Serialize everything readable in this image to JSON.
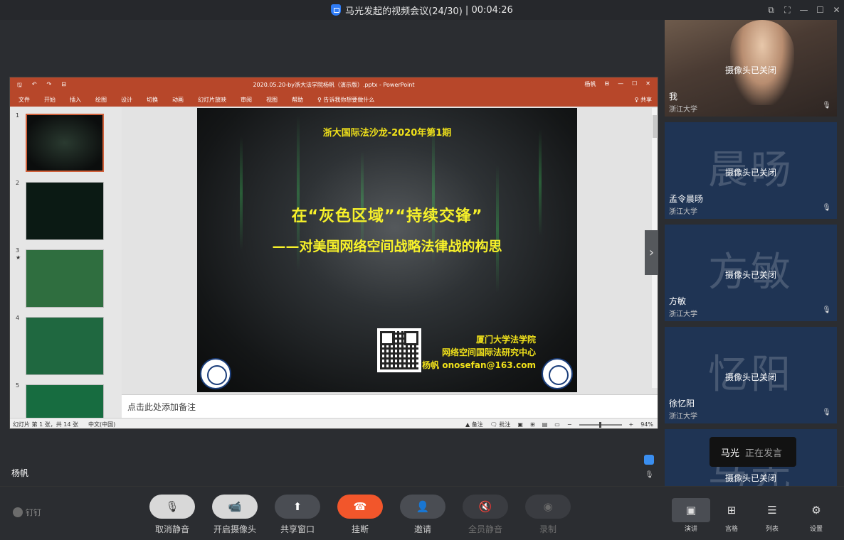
{
  "window": {
    "title": "马光发起的视频会议(24/30)",
    "timer": "00:04:26",
    "controls": [
      "⧉",
      "⛶",
      "—",
      "☐",
      "✕"
    ]
  },
  "ppt": {
    "filename": "2020.05.20-by浙大法学院杨帆（演示版）.pptx - PowerPoint",
    "quick_access": [
      "🖫",
      "↶",
      "↷",
      "⊟"
    ],
    "title_right": [
      "杨帆",
      "⊟",
      "—",
      "☐",
      "✕"
    ],
    "tabs": [
      "文件",
      "开始",
      "插入",
      "绘图",
      "设计",
      "切换",
      "动画",
      "幻灯片放映",
      "审阅",
      "视图",
      "帮助",
      "♀ 告诉我你想要做什么"
    ],
    "share": "♀ 共享",
    "thumb_numbers": [
      "1",
      "2",
      "3",
      "4",
      "5"
    ],
    "thumb_star": "★",
    "notes_placeholder": "点击此处添加备注",
    "status_left": "幻灯片 第 1 张，共 14 张",
    "status_lang": "中文(中国)",
    "status_notes": "▲ 备注",
    "status_comments": "🗨 批注",
    "zoom": "94%",
    "slide": {
      "subtitle": "浙大国际法沙龙-2020年第1期",
      "title_line1": "在“灰色区域”“持续交锋”",
      "title_line2": "——对美国网络空间战略法律战的构思",
      "info_line1": "厦门大学法学院",
      "info_line2": "网络空间国际法研究中心",
      "info_line3": "杨帆  onosefan@163.com"
    }
  },
  "presenter_name": "杨帆",
  "participants": [
    {
      "name": "我",
      "org": "浙江大学",
      "status": "摄像头已关闭",
      "watermark": ""
    },
    {
      "name": "孟令晨旸",
      "org": "浙江大学",
      "status": "摄像头已关闭",
      "watermark": "晨旸"
    },
    {
      "name": "方敏",
      "org": "浙江大学",
      "status": "摄像头已关闭",
      "watermark": "方敏"
    },
    {
      "name": "徐忆阳",
      "org": "浙江大学",
      "status": "摄像头已关闭",
      "watermark": "忆阳"
    },
    {
      "name": "",
      "org": "",
      "status": "摄像头已关闭",
      "watermark": "马光"
    }
  ],
  "speaking": {
    "who": "马光",
    "state": "正在发言"
  },
  "brand": "钉钉",
  "controls": [
    {
      "label": "取消静音",
      "icon": "🎙"
    },
    {
      "label": "开启摄像头",
      "icon": "📹"
    },
    {
      "label": "共享窗口",
      "icon": "⬆"
    },
    {
      "label": "挂断",
      "icon": "☎"
    },
    {
      "label": "邀请",
      "icon": "👤"
    },
    {
      "label": "全员静音",
      "icon": "🔇"
    },
    {
      "label": "录制",
      "icon": "◉"
    }
  ],
  "views": [
    {
      "label": "演讲",
      "icon": "▣"
    },
    {
      "label": "宫格",
      "icon": "⊞"
    },
    {
      "label": "列表",
      "icon": "☰"
    },
    {
      "label": "设置",
      "icon": "⚙"
    }
  ]
}
